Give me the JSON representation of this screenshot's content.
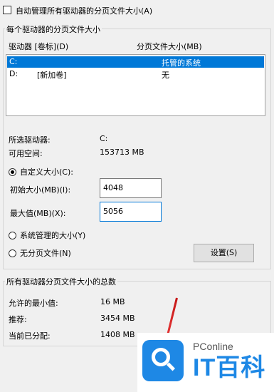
{
  "auto_manage_label": "自动管理所有驱动器的分页文件大小(A)",
  "per_drive_group_title": "每个驱动器的分页文件大小",
  "list": {
    "col_drive": "驱动器 [卷标](D)",
    "col_size": "分页文件大小(MB)",
    "rows": [
      {
        "drive": "C:",
        "label": "",
        "size": "托管的系统",
        "selected": true
      },
      {
        "drive": "D:",
        "label": "[新加卷]",
        "size": "无",
        "selected": false
      }
    ]
  },
  "selected_drive_label": "所选驱动器:",
  "selected_drive_value": "C:",
  "free_space_label": "可用空间:",
  "free_space_value": "153713 MB",
  "custom_size_label": "自定义大小(C):",
  "initial_size_label": "初始大小(MB)(I):",
  "initial_size_value": "4048",
  "max_size_label": "最大值(MB)(X):",
  "max_size_value": "5056",
  "system_managed_label": "系统管理的大小(Y)",
  "no_paging_label": "无分页文件(N)",
  "set_button_label": "设置(S)",
  "total_group_title": "所有驱动器分页文件大小的总数",
  "min_allowed_label": "允许的最小值:",
  "min_allowed_value": "16 MB",
  "recommended_label": "推荐:",
  "recommended_value": "3454 MB",
  "allocated_label": "当前已分配:",
  "allocated_value": "1408 MB",
  "watermark": {
    "site": "PConline",
    "brand": "IT百科"
  }
}
